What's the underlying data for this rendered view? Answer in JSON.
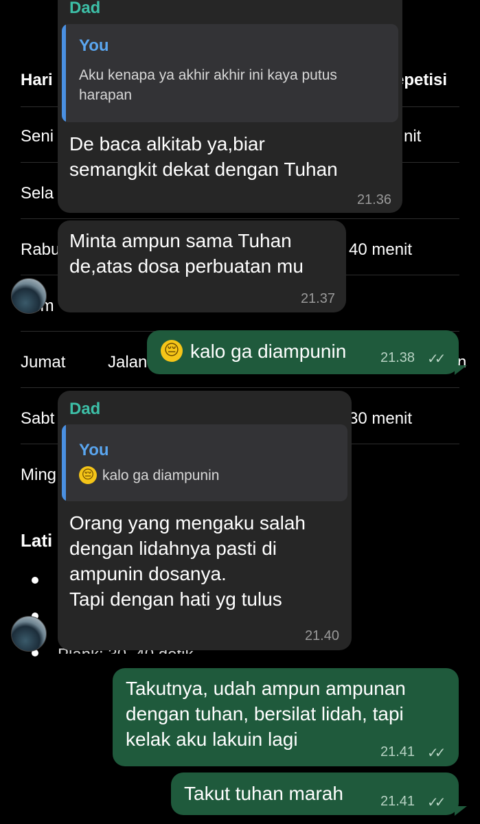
{
  "background": {
    "header": {
      "col1": "Hari",
      "col3": "epetisi"
    },
    "rows": [
      {
        "day": "Seni",
        "right": "nit"
      },
      {
        "day": "Sela",
        "right": ""
      },
      {
        "day": "Rabu",
        "right": "40 menit"
      },
      {
        "day": ".m",
        "right": ""
      },
      {
        "day": "Jumat",
        "mid": "Jalan",
        "right": "n"
      },
      {
        "day": "Sabt",
        "right": "30 menit"
      },
      {
        "day": "Ming",
        "right": ""
      }
    ],
    "section_title": "Lati",
    "bullet_last": "Plank: 30–40 detik"
  },
  "chat": {
    "messages": [
      {
        "sender": "Dad",
        "quote_name": "You",
        "quote_text": "Aku kenapa ya akhir akhir ini kaya putus\nharapan",
        "text": "De baca alkitab ya,biar\nsemangkit dekat dengan Tuhan",
        "time": "21.36"
      },
      {
        "text": "Minta ampun sama Tuhan\nde,atas dosa perbuatan mu",
        "time": "21.37"
      },
      {
        "emoji": "😔",
        "text": "kalo ga diampunin",
        "time": "21.38",
        "status": "✓✓"
      },
      {
        "sender": "Dad",
        "quote_name": "You",
        "quote_emoji": "😔",
        "quote_text": "kalo ga diampunin",
        "text": "Orang yang mengaku salah\ndengan lidahnya pasti di\nampunin dosanya.\nTapi dengan hati yg tulus",
        "time": "21.40"
      },
      {
        "text": "Takutnya, udah ampun ampunan\ndengan tuhan, bersilat lidah, tapi\nkelak aku lakuin lagi",
        "time": "21.41",
        "status": "✓✓"
      },
      {
        "text": "Takut tuhan marah",
        "time": "21.41",
        "status": "✓✓"
      }
    ]
  },
  "colors": {
    "incoming_bubble": "#262626",
    "outgoing_bubble": "#1f5a3c",
    "sender_name": "#3dbfa7",
    "quote_accent": "#4a90e2"
  }
}
